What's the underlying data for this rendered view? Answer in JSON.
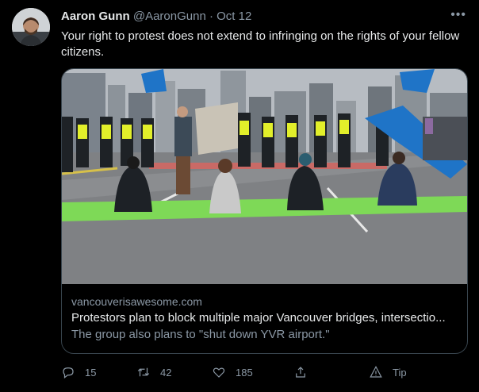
{
  "tweet": {
    "author_name": "Aaron Gunn",
    "author_handle": "@AaronGunn",
    "separator": "·",
    "date": "Oct 12",
    "text": "Your right to protest does not extend to infringing on the rights of your fellow citizens.",
    "more_icon": "more-icon"
  },
  "card": {
    "domain": "vancouverisawesome.com",
    "headline": "Protestors plan to block multiple major Vancouver bridges, intersectio...",
    "description": "The group also plans to \"shut down YVR airport.\""
  },
  "actions": {
    "replies": "15",
    "retweets": "42",
    "likes": "185",
    "tip_label": "Tip"
  },
  "colors": {
    "background": "#000000",
    "text": "#e7e9ea",
    "muted": "#8b98a5",
    "border": "#38444d",
    "banner_green": "#7ed957",
    "flag_blue": "#1f74c7"
  }
}
